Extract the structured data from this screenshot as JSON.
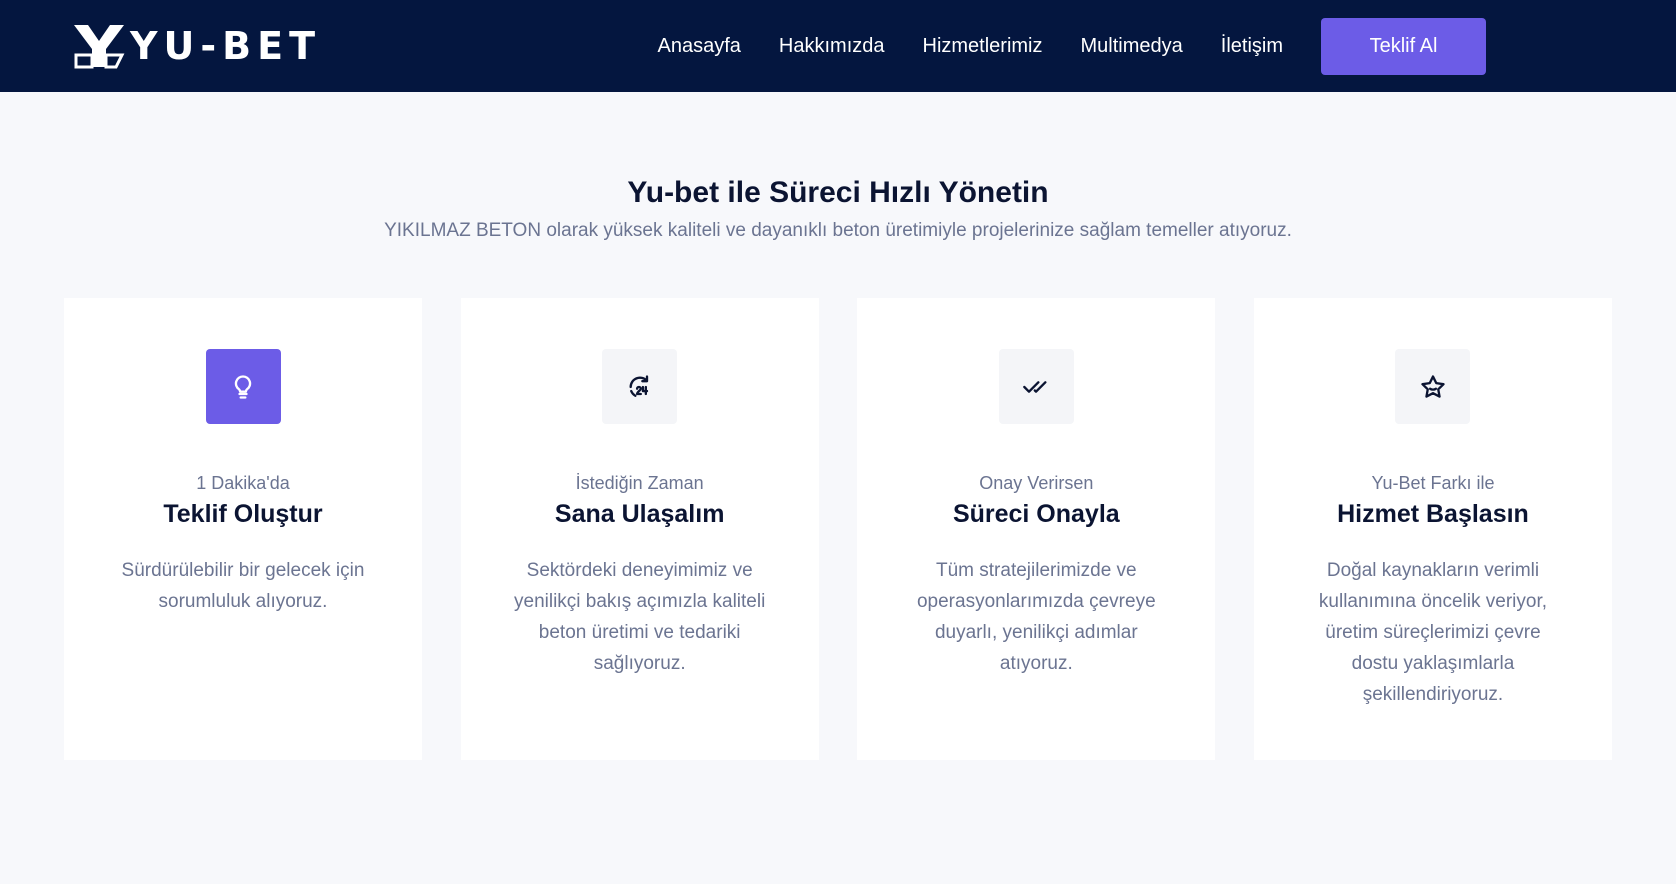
{
  "brand": {
    "name": "YU-BET"
  },
  "nav": {
    "items": [
      "Anasayfa",
      "Hakkımızda",
      "Hizmetlerimiz",
      "Multimedya",
      "İletişim"
    ],
    "cta": "Teklif Al"
  },
  "section": {
    "title": "Yu-bet ile Süreci Hızlı Yönetin",
    "subtitle": "YIKILMAZ BETON olarak yüksek kaliteli ve dayanıklı beton üretimiyle projelerinize sağlam temeller atıyoruz."
  },
  "cards": [
    {
      "icon": "lightbulb-icon",
      "eyebrow": "1 Dakika'da",
      "title": "Teklif Oluştur",
      "description": "Sürdürülebilir bir gelecek için sorumluluk alıyoruz."
    },
    {
      "icon": "clock-24-icon",
      "eyebrow": "İstediğin Zaman",
      "title": "Sana Ulaşalım",
      "description": "Sektördeki deneyimimiz ve yenilikçi bakış açımızla kaliteli beton üretimi ve tedariki sağlıyoruz."
    },
    {
      "icon": "double-check-icon",
      "eyebrow": "Onay Verirsen",
      "title": "Süreci Onayla",
      "description": "Tüm stratejilerimizde ve operasyonlarımızda çevreye duyarlı, yenilikçi adımlar atıyoruz."
    },
    {
      "icon": "star-icon",
      "eyebrow": "Yu-Bet Farkı ile",
      "title": "Hizmet Başlasın",
      "description": "Doğal kaynakların verimli kullanımına öncelik veriyor, üretim süreçlerimizi çevre dostu yaklaşımlarla şekillendiriyoruz."
    }
  ],
  "colors": {
    "navbar": "#04163f",
    "accent": "#6c5ce7",
    "background": "#f7f8fb",
    "heading": "#0b1432",
    "muted": "#6b7491"
  }
}
